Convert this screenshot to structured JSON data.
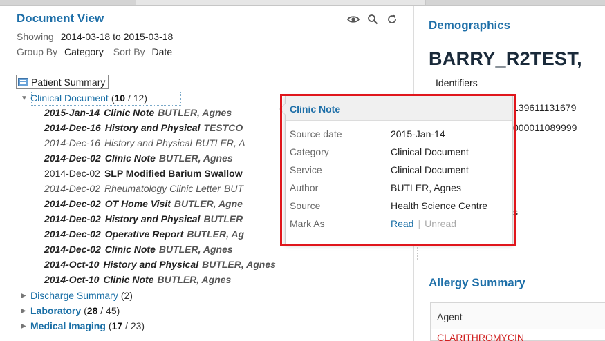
{
  "document_view": {
    "title": "Document View",
    "showing_label": "Showing",
    "showing_range": "2014-03-18 to 2015-03-18",
    "group_by_label": "Group By",
    "group_by_value": "Category",
    "sort_by_label": "Sort By",
    "sort_by_value": "Date",
    "icons": [
      "eye-icon",
      "search-icon",
      "refresh-icon"
    ],
    "patient_summary_label": "Patient Summary",
    "clinical_document": {
      "name": "Clinical Document",
      "count_open": "(",
      "count_bold": "10",
      "count_rest": " / 12)"
    },
    "docs": [
      {
        "date": "2015-Jan-14",
        "title": "Clinic Note",
        "author": "BUTLER, Agnes"
      },
      {
        "date": "2014-Dec-16",
        "title": "History and Physical",
        "author": "TESTCO"
      },
      {
        "date": "2014-Dec-16",
        "title": "History and Physical",
        "author": "BUTLER, A"
      },
      {
        "date": "2014-Dec-02",
        "title": "Clinic Note",
        "author": "BUTLER, Agnes"
      },
      {
        "date": "2014-Dec-02",
        "title": "SLP Modified Barium Swallow",
        "author": ""
      },
      {
        "date": "2014-Dec-02",
        "title": "Rheumatology Clinic Letter",
        "author": "BUT"
      },
      {
        "date": "2014-Dec-02",
        "title": "OT Home Visit",
        "author": "BUTLER, Agne"
      },
      {
        "date": "2014-Dec-02",
        "title": "History and Physical",
        "author": "BUTLER"
      },
      {
        "date": "2014-Dec-02",
        "title": "Operative Report",
        "author": "BUTLER, Ag"
      },
      {
        "date": "2014-Dec-02",
        "title": "Clinic Note",
        "author": "BUTLER, Agnes"
      },
      {
        "date": "2014-Oct-10",
        "title": "History and Physical",
        "author": "BUTLER, Agnes"
      },
      {
        "date": "2014-Oct-10",
        "title": "Clinic Note",
        "author": "BUTLER, Agnes"
      }
    ],
    "groups": [
      {
        "name": "Discharge Summary",
        "count_open": "(",
        "count_bold": "",
        "count_rest": "2)"
      },
      {
        "name": "Laboratory",
        "count_open": "(",
        "count_bold": "28",
        "count_rest": " / 45)"
      },
      {
        "name": "Medical Imaging",
        "count_open": "(",
        "count_bold": "17",
        "count_rest": " / 23)"
      }
    ]
  },
  "demographics": {
    "title": "Demographics",
    "patient_name": "BARRY_R2TEST,",
    "identifiers_label": "Identifiers",
    "identifier_1": "139611131679",
    "identifier_2": "000011089999",
    "partial_text": "s"
  },
  "allergy": {
    "title": "Allergy Summary",
    "agent_header": "Agent",
    "first_agent": "CLARITHROMYCIN"
  },
  "popover": {
    "title": "Clinic Note",
    "source_date_label": "Source date",
    "source_date_value": "2015-Jan-14",
    "category_label": "Category",
    "category_value": "Clinical Document",
    "service_label": "Service",
    "service_value": "Clinical Document",
    "author_label": "Author",
    "author_value": "BUTLER, Agnes",
    "source_label": "Source",
    "source_value": "Health Science Centre",
    "mark_as_label": "Mark As",
    "read_label": "Read",
    "separator": "|",
    "unread_label": "Unread"
  },
  "colors": {
    "accent": "#1e6fa8",
    "highlight_border": "#e0161c",
    "allergy_red": "#d02020"
  }
}
